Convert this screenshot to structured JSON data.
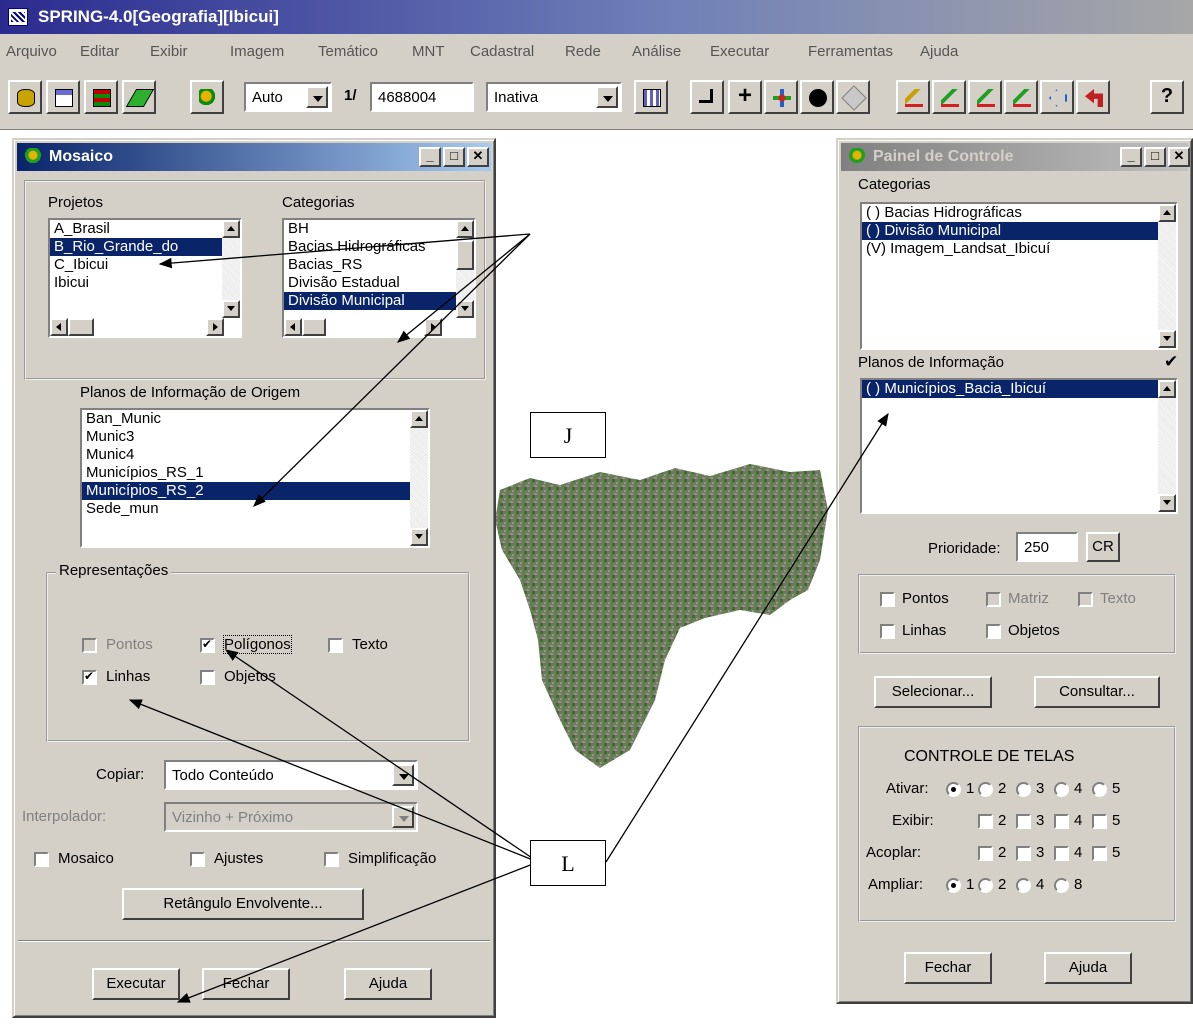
{
  "app": {
    "title": "SPRING-4.0[Geografia][Ibicui]",
    "menu": [
      "Arquivo",
      "Editar",
      "Exibir",
      "Imagem",
      "Temático",
      "MNT",
      "Cadastral",
      "Rede",
      "Análise",
      "Executar",
      "Ferramentas",
      "Ajuda"
    ]
  },
  "toolbar": {
    "scale_mode": "Auto",
    "scale_prefix": "1/",
    "scale_value": "4688004",
    "state": "Inativa",
    "help_label": "?"
  },
  "mosaico": {
    "title": "Mosaico",
    "projetos_label": "Projetos",
    "projetos": [
      "A_Brasil",
      "B_Rio_Grande_do",
      "C_Ibicui",
      "Ibicui"
    ],
    "projeto_selected": 1,
    "categorias_label": "Categorias",
    "categorias": [
      "BH",
      "Bacias Hidrográficas",
      "Bacias_RS",
      "Divisão Estadual",
      "Divisão Municipal"
    ],
    "categoria_selected": 4,
    "planos_label": "Planos de Informação de Origem",
    "planos": [
      "Ban_Munic",
      "Munic3",
      "Munic4",
      "Municípios_RS_1",
      "Municípios_RS_2",
      "Sede_mun"
    ],
    "plano_selected": 4,
    "representacoes_label": "Representações",
    "rep": {
      "pontos": "Pontos",
      "poligonos": "Polígonos",
      "texto": "Texto",
      "linhas": "Linhas",
      "objetos": "Objetos"
    },
    "copiar_label": "Copiar:",
    "copiar_value": "Todo Conteúdo",
    "interpolador_label": "Interpolador:",
    "interpolador_value": "Vizinho + Próximo",
    "mosaico_label": "Mosaico",
    "ajustes_label": "Ajustes",
    "simplificacao_label": "Simplificação",
    "retangulo_button": "Retângulo Envolvente...",
    "executar_button": "Executar",
    "fechar_button": "Fechar",
    "ajuda_button": "Ajuda"
  },
  "painel": {
    "title": "Painel de Controle",
    "categorias_label": "Categorias",
    "categorias": [
      "( ) Bacias Hidrográficas",
      "( ) Divisão Municipal",
      "(V) Imagem_Landsat_Ibicuí"
    ],
    "categoria_selected": 1,
    "planos_label": "Planos de Informação",
    "check_mark": "✔",
    "planos": [
      "( ) Municípios_Bacia_Ibicuí"
    ],
    "plano_selected": 0,
    "prioridade_label": "Prioridade:",
    "prioridade_value": "250",
    "cr_button": "CR",
    "rep": {
      "pontos": "Pontos",
      "matriz": "Matriz",
      "texto": "Texto",
      "linhas": "Linhas",
      "objetos": "Objetos"
    },
    "selecionar_button": "Selecionar...",
    "consultar_button": "Consultar...",
    "telas_title": "CONTROLE DE TELAS",
    "ativar_label": "Ativar:",
    "exibir_label": "Exibir:",
    "acoplar_label": "Acoplar:",
    "ampliar_label": "Ampliar:",
    "n1": "1",
    "n2": "2",
    "n3": "3",
    "n4": "4",
    "n5": "5",
    "n8": "8",
    "fechar_button": "Fechar",
    "ajuda_button": "Ajuda"
  },
  "annotations": {
    "j": "J",
    "l": "L"
  }
}
